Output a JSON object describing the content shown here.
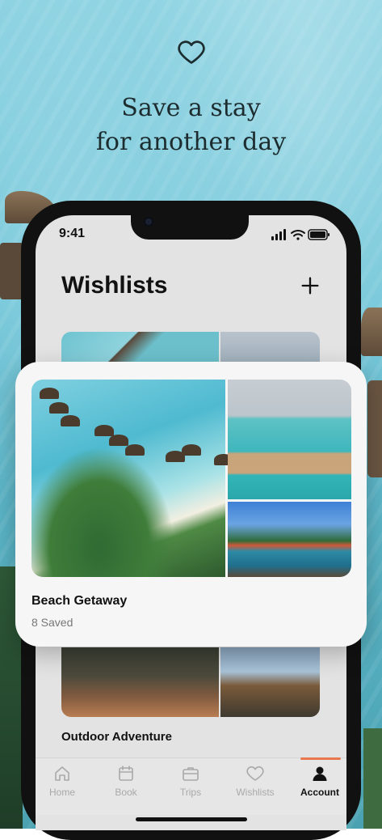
{
  "hero": {
    "line1": "Save a stay",
    "line2": "for another day",
    "icon": "heart-outline-icon"
  },
  "status_bar": {
    "time": "9:41",
    "icons": [
      "cellular-signal-icon",
      "wifi-icon",
      "battery-icon"
    ]
  },
  "page": {
    "title": "Wishlists",
    "add_icon": "plus-icon"
  },
  "wishlists": [
    {
      "name": "Beach Getaway",
      "count": "8 Saved"
    },
    {
      "name": "Outdoor Adventure"
    }
  ],
  "tabs": [
    {
      "label": "Home",
      "icon": "home-icon",
      "active": false
    },
    {
      "label": "Book",
      "icon": "calendar-icon",
      "active": false
    },
    {
      "label": "Trips",
      "icon": "suitcase-icon",
      "active": false
    },
    {
      "label": "Wishlists",
      "icon": "heart-icon",
      "active": false
    },
    {
      "label": "Account",
      "icon": "person-icon",
      "active": true
    }
  ],
  "colors": {
    "accent": "#e8794e",
    "inactive_tab": "#a9a9a9",
    "active_tab": "#111111"
  }
}
